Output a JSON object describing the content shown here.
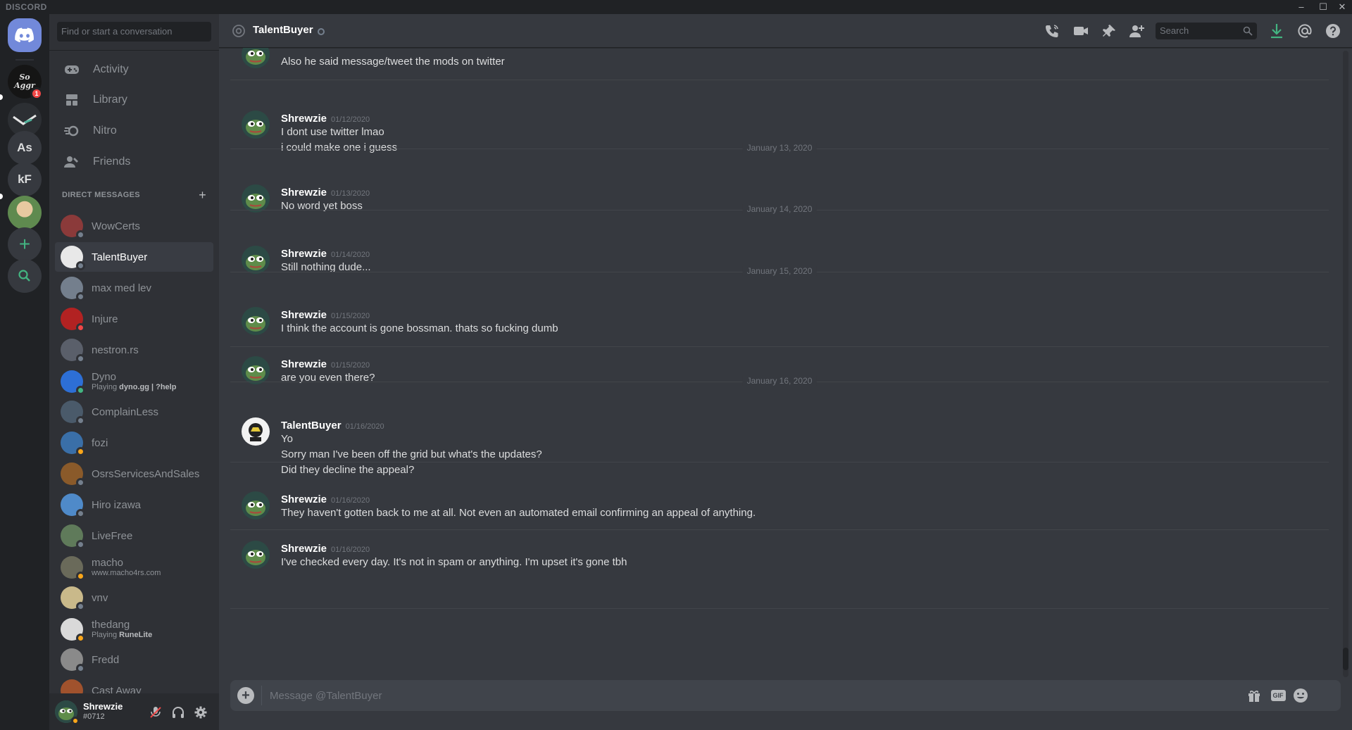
{
  "app": {
    "brand": "DISCORD"
  },
  "window_controls": {
    "minimize": "–",
    "maximize": "☐",
    "close": "✕"
  },
  "guilds": {
    "home_icon": "discord-logo-icon",
    "items": [
      {
        "label": "",
        "badge": "1",
        "color": "#151515"
      },
      {
        "label": "",
        "badge": "",
        "color": "#2c2f33"
      },
      {
        "label": "As",
        "badge": "",
        "color": "#36393f"
      },
      {
        "label": "kF",
        "badge": "",
        "color": "#36393f"
      },
      {
        "label": "",
        "badge": "",
        "color": "#6b8b5c"
      }
    ],
    "add_icon": "+",
    "explore_icon": "search-icon"
  },
  "sidebar": {
    "search_placeholder": "Find or start a conversation",
    "nav": [
      {
        "label": "Activity",
        "icon": "gamepad-icon"
      },
      {
        "label": "Library",
        "icon": "library-icon"
      },
      {
        "label": "Nitro",
        "icon": "nitro-icon"
      },
      {
        "label": "Friends",
        "icon": "friends-icon"
      }
    ],
    "dm_header": "DIRECT MESSAGES",
    "dm_add": "+",
    "dms": [
      {
        "name": "WowCerts",
        "sub": "",
        "sub_bold": "",
        "status": "#747f8d",
        "color": "#8b3a3a"
      },
      {
        "name": "TalentBuyer",
        "sub": "",
        "sub_bold": "",
        "status": "#747f8d",
        "color": "#e8e8e8"
      },
      {
        "name": "max med lev",
        "sub": "",
        "sub_bold": "",
        "status": "#747f8d",
        "color": "#747f8d"
      },
      {
        "name": "Injure",
        "sub": "",
        "sub_bold": "",
        "status": "#f04747",
        "color": "#b22222"
      },
      {
        "name": "nestron.rs",
        "sub": "",
        "sub_bold": "",
        "status": "#747f8d",
        "color": "#5a5f6a"
      },
      {
        "name": "Dyno",
        "sub": "Playing ",
        "sub_bold": "dyno.gg | ?help",
        "status": "#43b581",
        "color": "#2d6fd6"
      },
      {
        "name": "ComplainLess",
        "sub": "",
        "sub_bold": "",
        "status": "#747f8d",
        "color": "#4a5a6a"
      },
      {
        "name": "fozi",
        "sub": "",
        "sub_bold": "",
        "status": "#faa61a",
        "color": "#3a6fa8"
      },
      {
        "name": "OsrsServicesAndSales",
        "sub": "",
        "sub_bold": "",
        "status": "#747f8d",
        "color": "#8a5a2a"
      },
      {
        "name": "Hiro izawa",
        "sub": "",
        "sub_bold": "",
        "status": "#747f8d",
        "color": "#4f8ac9"
      },
      {
        "name": "LiveFree",
        "sub": "",
        "sub_bold": "",
        "status": "#747f8d",
        "color": "#5f7a5a"
      },
      {
        "name": "macho",
        "sub": "www.macho4rs.com",
        "sub_bold": "",
        "status": "#faa61a",
        "color": "#6a6a5a"
      },
      {
        "name": "vnv",
        "sub": "",
        "sub_bold": "",
        "status": "#747f8d",
        "color": "#c9b98a"
      },
      {
        "name": "thedang",
        "sub": "Playing ",
        "sub_bold": "RuneLite",
        "status": "#faa61a",
        "color": "#d9d9d9"
      },
      {
        "name": "Fredd",
        "sub": "",
        "sub_bold": "",
        "status": "#747f8d",
        "color": "#8a8a8a"
      },
      {
        "name": "Cast Away",
        "sub": "",
        "sub_bold": "",
        "status": "#747f8d",
        "color": "#a0522d"
      }
    ]
  },
  "user": {
    "name": "Shrewzie",
    "tag": "#0712"
  },
  "channel": {
    "name": "TalentBuyer",
    "search_placeholder": "Search",
    "composer_placeholder": "Message @TalentBuyer"
  },
  "messages": [
    {
      "author": "",
      "time": "",
      "lines": [
        "Also he said message/tweet the mods on twitter"
      ],
      "avatar": "pepe"
    },
    {
      "author": "Shrewzie",
      "time": "01/12/2020",
      "lines": [
        "I dont use twitter lmao",
        "i could make one i guess"
      ],
      "avatar": "pepe"
    },
    {
      "date": "January 13, 2020"
    },
    {
      "author": "Shrewzie",
      "time": "01/13/2020",
      "lines": [
        "No word yet boss"
      ],
      "avatar": "pepe"
    },
    {
      "date": "January 14, 2020"
    },
    {
      "author": "Shrewzie",
      "time": "01/14/2020",
      "lines": [
        "Still nothing dude..."
      ],
      "avatar": "pepe"
    },
    {
      "date": "January 15, 2020"
    },
    {
      "author": "Shrewzie",
      "time": "01/15/2020",
      "lines": [
        "I think the account is gone bossman. thats so fucking dumb"
      ],
      "avatar": "pepe"
    },
    {
      "author": "Shrewzie",
      "time": "01/15/2020",
      "lines": [
        "are you even there?"
      ],
      "avatar": "pepe"
    },
    {
      "date": "January 16, 2020"
    },
    {
      "author": "TalentBuyer",
      "time": "01/16/2020",
      "lines": [
        "Yo",
        "Sorry man I've been off the grid but what's the updates?",
        "Did they decline the appeal?"
      ],
      "avatar": "talent"
    },
    {
      "author": "Shrewzie",
      "time": "01/16/2020",
      "lines": [
        "They haven't gotten back to me at all. Not even an automated email confirming an appeal of anything."
      ],
      "avatar": "pepe"
    },
    {
      "author": "Shrewzie",
      "time": "01/16/2020",
      "lines": [
        "I've checked every day. It's not in spam or anything. I'm upset it's gone tbh"
      ],
      "avatar": "pepe"
    }
  ],
  "composer": {
    "gif_label": "GIF"
  },
  "colors": {
    "accent": "#7289da",
    "online": "#43b581",
    "idle": "#faa61a",
    "dnd": "#f04747",
    "offline": "#747f8d"
  }
}
